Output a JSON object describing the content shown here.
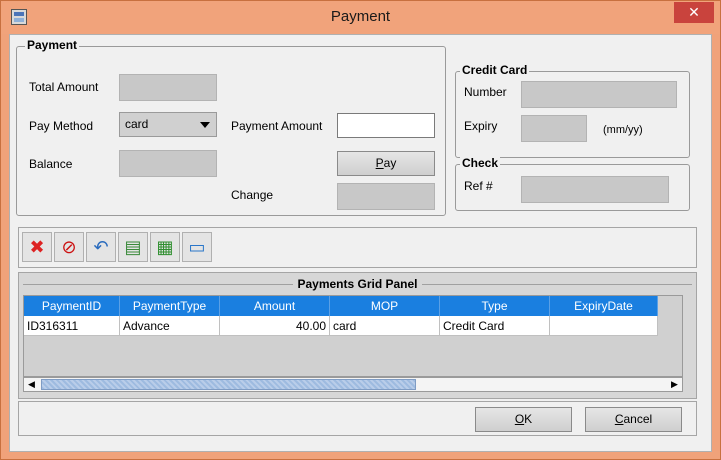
{
  "window": {
    "title": "Payment",
    "close_glyph": "✕"
  },
  "payment": {
    "legend": "Payment",
    "total_amount_label": "Total Amount",
    "total_amount_value": "",
    "pay_method_label": "Pay Method",
    "pay_method_value": "card",
    "balance_label": "Balance",
    "balance_value": "",
    "payment_amount_label": "Payment Amount",
    "payment_amount_value": "",
    "pay_button": "Pay",
    "change_label": "Change",
    "change_value": ""
  },
  "credit_card": {
    "legend": "Credit Card",
    "number_label": "Number",
    "number_value": "",
    "expiry_label": "Expiry",
    "expiry_value": "",
    "expiry_hint": "(mm/yy)"
  },
  "check": {
    "legend": "Check",
    "ref_label": "Ref #",
    "ref_value": ""
  },
  "toolbar": {
    "items": [
      {
        "icon": "delete-x-icon",
        "glyph": "✖"
      },
      {
        "icon": "cancel-icon",
        "glyph": "⊘"
      },
      {
        "icon": "undo-icon",
        "glyph": "↶"
      },
      {
        "icon": "print-icon",
        "glyph": "▤"
      },
      {
        "icon": "save-icon",
        "glyph": "▦"
      },
      {
        "icon": "card-icon",
        "glyph": "▭"
      }
    ]
  },
  "grid": {
    "title": "Payments Grid Panel",
    "columns": [
      "PaymentID",
      "PaymentType",
      "Amount",
      "MOP",
      "Type",
      "ExpiryDate"
    ],
    "rows": [
      [
        "ID316311",
        "Advance",
        "40.00",
        "card",
        "Credit Card",
        ""
      ]
    ]
  },
  "footer": {
    "ok_button": "OK",
    "cancel_button": "Cancel"
  },
  "colors": {
    "title_bar": "#f1a37b",
    "close_button": "#c9433d",
    "grid_header": "#1a7fe0"
  }
}
